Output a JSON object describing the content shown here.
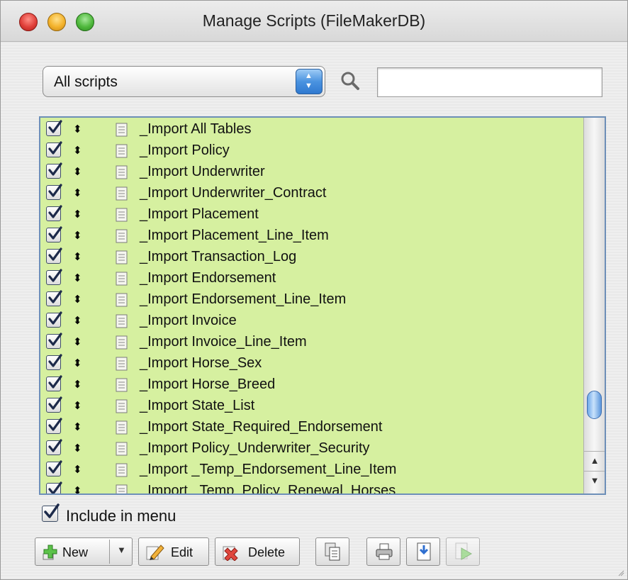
{
  "window": {
    "title": "Manage Scripts (FileMakerDB)"
  },
  "filter": {
    "popup_value": "All scripts",
    "search_value": ""
  },
  "scripts": [
    {
      "label": "_Import All Tables",
      "checked": true
    },
    {
      "label": "_Import Policy",
      "checked": true
    },
    {
      "label": "_Import Underwriter",
      "checked": true
    },
    {
      "label": "_Import Underwriter_Contract",
      "checked": true
    },
    {
      "label": "_Import Placement",
      "checked": true
    },
    {
      "label": "_Import Placement_Line_Item",
      "checked": true
    },
    {
      "label": "_Import Transaction_Log",
      "checked": true
    },
    {
      "label": "_Import Endorsement",
      "checked": true
    },
    {
      "label": "_Import Endorsement_Line_Item",
      "checked": true
    },
    {
      "label": "_Import Invoice",
      "checked": true
    },
    {
      "label": "_Import Invoice_Line_Item",
      "checked": true
    },
    {
      "label": "_Import Horse_Sex",
      "checked": true
    },
    {
      "label": "_Import Horse_Breed",
      "checked": true
    },
    {
      "label": "_Import State_List",
      "checked": true
    },
    {
      "label": "_Import State_Required_Endorsement",
      "checked": true
    },
    {
      "label": "_Import Policy_Underwriter_Security",
      "checked": true
    },
    {
      "label": "_Import _Temp_Endorsement_Line_Item",
      "checked": true
    },
    {
      "label": "_Import _Temp_Policy_Renewal_Horses",
      "checked": true
    }
  ],
  "include_in_menu": {
    "label": "Include in menu",
    "checked": true
  },
  "buttons": {
    "new_label": "New",
    "edit_label": "Edit",
    "delete_label": "Delete"
  },
  "colors": {
    "list_background": "#d6f0a0",
    "list_border": "#6d8fb8",
    "accent": "#4b93e0"
  }
}
